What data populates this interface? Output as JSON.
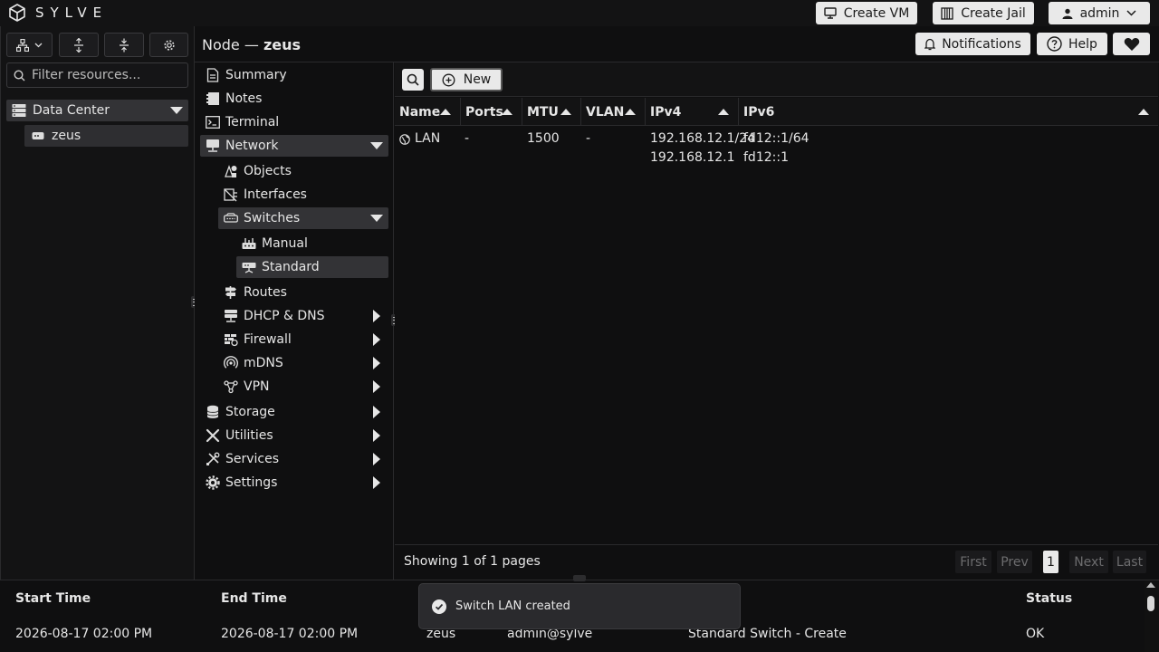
{
  "app": {
    "brand": "SYLVE"
  },
  "topbar": {
    "create_vm": "Create VM",
    "create_jail": "Create Jail",
    "user": "admin"
  },
  "sidebar": {
    "filter_placeholder": "Filter resources...",
    "datacenter": "Data Center",
    "node": "zeus"
  },
  "header": {
    "node_prefix": "Node —",
    "node_name": "zeus",
    "notifications": "Notifications",
    "help": "Help"
  },
  "nav": {
    "summary": "Summary",
    "notes": "Notes",
    "terminal": "Terminal",
    "network": "Network",
    "objects": "Objects",
    "interfaces": "Interfaces",
    "switches": "Switches",
    "manual": "Manual",
    "standard": "Standard",
    "routes": "Routes",
    "dhcp_dns": "DHCP & DNS",
    "firewall": "Firewall",
    "mdns": "mDNS",
    "vpn": "VPN",
    "storage": "Storage",
    "utilities": "Utilities",
    "services": "Services",
    "settings": "Settings"
  },
  "toolbar": {
    "new_label": "New"
  },
  "table": {
    "columns": [
      "Name",
      "Ports",
      "MTU",
      "VLAN",
      "IPv4",
      "IPv6"
    ],
    "rows": [
      {
        "name": "LAN",
        "ports": "-",
        "mtu": "1500",
        "vlan": "-",
        "ipv4": [
          "192.168.12.1/24",
          "192.168.12.1"
        ],
        "ipv6": [
          "fd12::1/64",
          "fd12::1"
        ]
      }
    ]
  },
  "pager": {
    "summary": "Showing 1 of 1 pages",
    "first": "First",
    "prev": "Prev",
    "current": "1",
    "next": "Next",
    "last": "Last"
  },
  "tasks": {
    "columns": {
      "start": "Start Time",
      "end": "End Time",
      "status": "Status"
    },
    "row": {
      "start": "2026-08-17 02:00 PM",
      "end": "2026-08-17 02:00 PM",
      "node": "zeus",
      "user": "admin@sylve",
      "action": "Standard Switch - Create",
      "status": "OK"
    }
  },
  "toast": {
    "message": "Switch LAN created"
  },
  "colors": {
    "background": "#0f0f10",
    "panel": "#131314",
    "selected": "#333336",
    "button": "#e9e9e9"
  }
}
